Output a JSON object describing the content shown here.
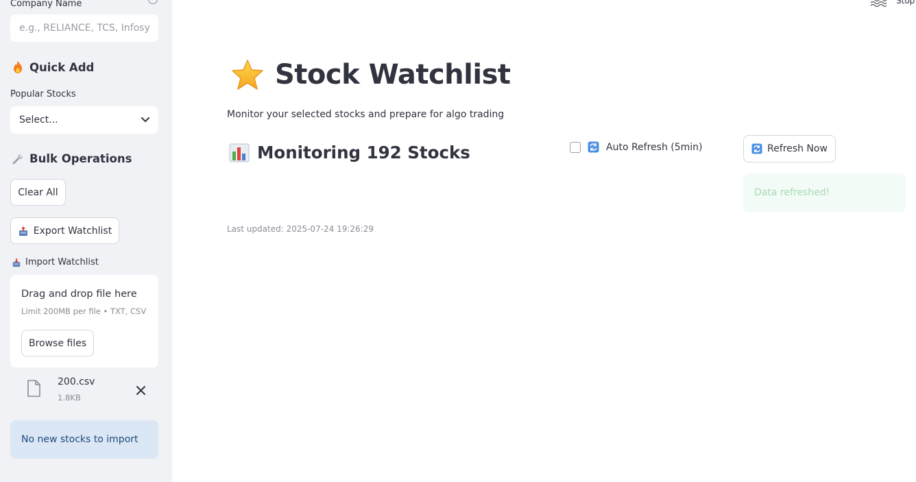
{
  "sidebar": {
    "company_name_label": "Company Name",
    "company_placeholder": "e.g., RELIANCE, TCS, Infosys",
    "quick_add": {
      "icon": "fire-icon",
      "title": "Quick Add"
    },
    "popular_label": "Popular Stocks",
    "popular_select_value": "Select...",
    "bulk_ops": {
      "icon": "wrench-icon",
      "title": "Bulk Operations"
    },
    "clear_all_label": "Clear All",
    "export_label": "Export Watchlist",
    "import_label": "Import Watchlist",
    "uploader": {
      "drag_text": "Drag and drop file here",
      "limit_text": "Limit 200MB per file • TXT, CSV",
      "browse_label": "Browse files"
    },
    "file": {
      "name": "200.csv",
      "size": "1.8KB"
    },
    "info_message": "No new stocks to import"
  },
  "header": {
    "stop_label": "Stop"
  },
  "main": {
    "title": "Stock Watchlist",
    "title_icon": "star-icon",
    "subtitle": "Monitor your selected stocks and prepare for algo trading",
    "section_title": "Monitoring 192 Stocks",
    "section_icon": "bar-chart-icon",
    "auto_refresh_label": "Auto Refresh (5min)",
    "auto_refresh_checked": false,
    "refresh_now_label": "Refresh Now",
    "toast_message": "Data refreshed!",
    "last_updated": "Last updated: 2025-07-24 19:26:29"
  },
  "colors": {
    "sidebar_bg": "#f0f2f6",
    "text": "#31333f",
    "info_bg": "#dbe7f5",
    "info_text": "#1f4a7c",
    "success_bg": "#f2fbf5",
    "success_text": "#a8d8b8"
  }
}
